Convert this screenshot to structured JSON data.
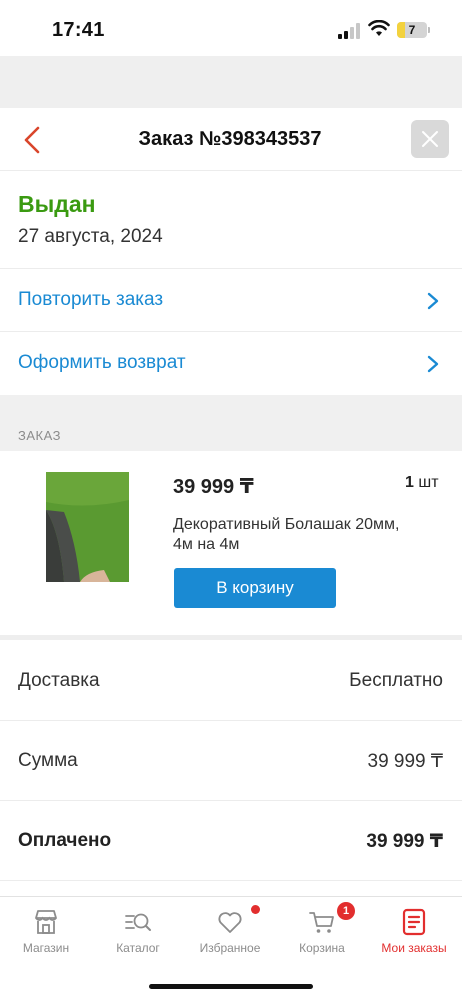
{
  "status_bar": {
    "time": "17:41",
    "battery": "7"
  },
  "header": {
    "title": "Заказ №398343537"
  },
  "order_status": {
    "label": "Выдан",
    "date": "27 августа, 2024"
  },
  "actions": [
    {
      "label": "Повторить заказ"
    },
    {
      "label": "Оформить возврат"
    }
  ],
  "section_label": "ЗАКАЗ",
  "product": {
    "price": "39 999 ₸",
    "quantity": "1",
    "quantity_unit": "шт",
    "name": "Декоративный Болашак 20мм, 4м на 4м",
    "cart_button": "В корзину"
  },
  "summary": [
    {
      "label": "Доставка",
      "value": "Бесплатно"
    },
    {
      "label": "Сумма",
      "value": "39 999 ₸"
    },
    {
      "label": "Оплачено",
      "value": "39 999 ₸"
    }
  ],
  "tabs": [
    {
      "label": "Магазин",
      "icon": "store-icon"
    },
    {
      "label": "Каталог",
      "icon": "catalog-search-icon"
    },
    {
      "label": "Избранное",
      "icon": "heart-icon"
    },
    {
      "label": "Корзина",
      "icon": "cart-icon",
      "badge": "1"
    },
    {
      "label": "Мои заказы",
      "icon": "orders-icon"
    }
  ],
  "colors": {
    "accent_blue": "#1a8ad3",
    "status_green": "#3a9a11",
    "active_red": "#e22e2e"
  }
}
